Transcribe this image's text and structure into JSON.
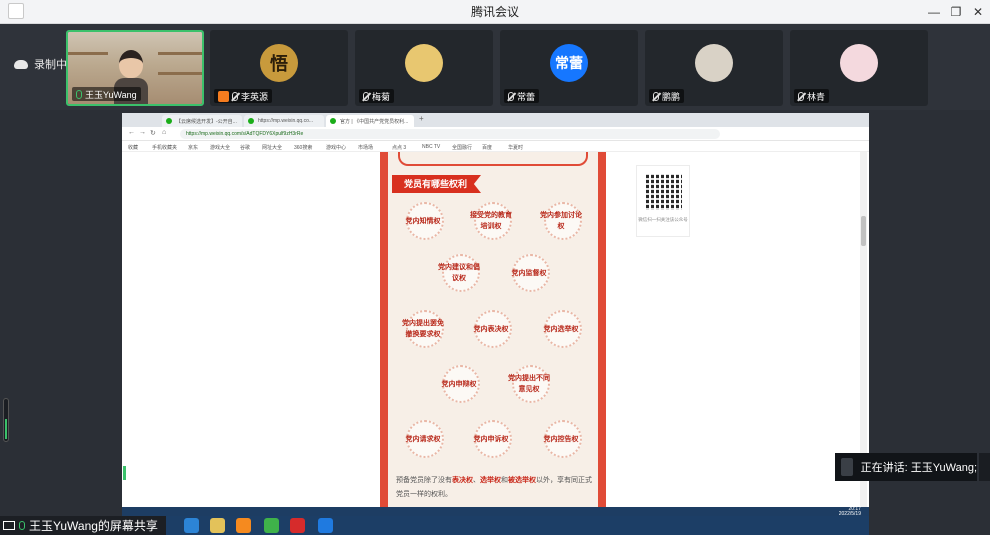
{
  "window": {
    "title": "腾讯会议",
    "controls": {
      "minimize": "—",
      "restore": "❐",
      "close": "✕"
    }
  },
  "recording": {
    "label": "录制中",
    "icon": "cloud-icon"
  },
  "participants": [
    {
      "name": "王玉YuWang",
      "mic": "on",
      "video": true
    },
    {
      "name": "李英源",
      "mic": "muted",
      "avatar_text": "悟",
      "avatar_color": "#c89a3c"
    },
    {
      "name": "梅菊",
      "mic": "muted",
      "avatar_text": "",
      "avatar_color": "#e8c770"
    },
    {
      "name": "常蕾",
      "mic": "muted",
      "avatar_text": "常蕾",
      "avatar_color": "#1677ff"
    },
    {
      "name": "鹏鹏",
      "mic": "muted",
      "avatar_text": "",
      "avatar_color": "#d9d2c6"
    },
    {
      "name": "林青",
      "mic": "muted",
      "avatar_text": "",
      "avatar_color": "#f4d9de"
    }
  ],
  "browser": {
    "tabs": [
      "【云席候选开发】-公开自...",
      "https://mp.weixin.qq.co...",
      "官方 | 《中国共产党党员权利..."
    ],
    "url": "https://mp.weixin.qq.com/s/AdTQFDY6Xpulf9zH3rRe",
    "bookmarks": [
      "收藏",
      "手机收藏夹",
      "京东",
      "游戏大全",
      "谷歌",
      "网址大全",
      "360搜索",
      "游戏中心",
      "市场场",
      "点点 3",
      "NBC TV",
      "全国融行",
      "百度",
      "华夏时"
    ]
  },
  "article": {
    "section_title": "党员有哪些权利",
    "rights": [
      "党内知情权",
      "接受党的教育培训权",
      "党内参加讨论权",
      "党内建议和倡议权",
      "党内监督权",
      "党内提出罢免撤换要求权",
      "党内表决权",
      "党内选举权",
      "党内申辩权",
      "党内提出不同意见权",
      "党内请求权",
      "党内申诉权",
      "党内控告权"
    ],
    "paragraph_prefix": "预备党员除了没有",
    "paragraph_b1": "表决权",
    "paragraph_sep1": "、",
    "paragraph_b2": "选举权",
    "paragraph_sep2": "和",
    "paragraph_b3": "被选举权",
    "paragraph_suffix": "以外，享有同正式党员一样的权利。"
  },
  "qr": {
    "caption": "微信扫一扫关注该公众号"
  },
  "system_clock": {
    "time": "20:17",
    "date": "2022/5/19"
  },
  "speaking": {
    "label": "正在讲话: 王玉YuWang;"
  },
  "share_label": "王玉YuWang的屏幕共享"
}
